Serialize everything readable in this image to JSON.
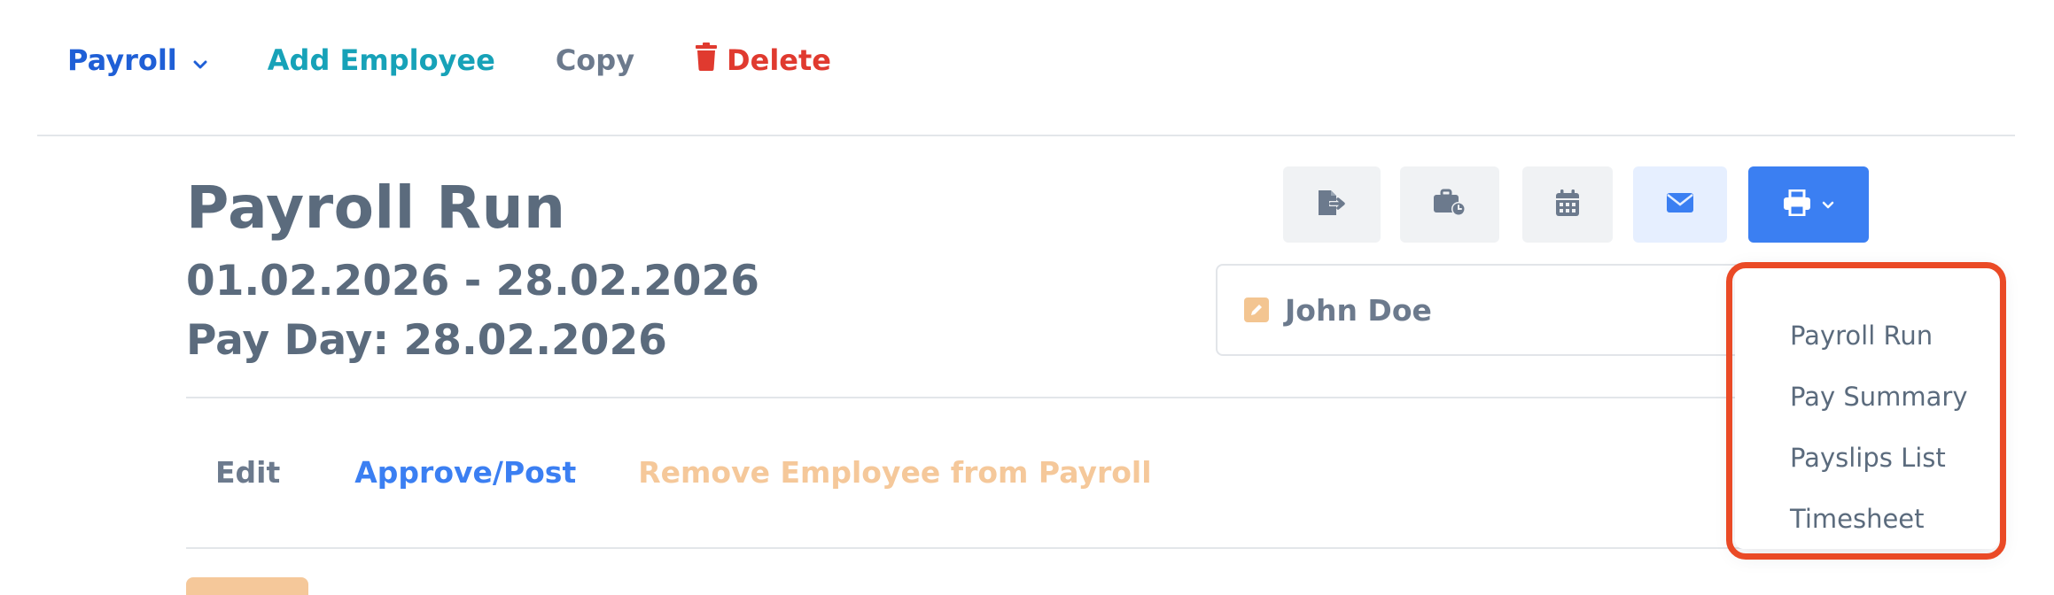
{
  "toolbar": {
    "payroll_label": "Payroll",
    "add_employee_label": "Add Employee",
    "copy_label": "Copy",
    "delete_label": "Delete"
  },
  "header": {
    "title": "Payroll Run",
    "date_range": "01.02.2026 - 28.02.2026",
    "pay_day": "Pay Day: 28.02.2026"
  },
  "actions": {
    "icons": [
      "file-export-icon",
      "briefcase-clock-icon",
      "calendar-icon",
      "envelope-icon",
      "printer-icon"
    ]
  },
  "employee_selector": {
    "selected": "John Doe"
  },
  "tabs": [
    {
      "label": "Edit"
    },
    {
      "label": "Approve/Post"
    },
    {
      "label": "Remove Employee from Payroll"
    }
  ],
  "print_menu": {
    "items": [
      {
        "label": "Payroll Run"
      },
      {
        "label": "Pay Summary"
      },
      {
        "label": "Payslips List"
      },
      {
        "label": "Timesheet"
      }
    ]
  },
  "colors": {
    "primary": "#3b7ff2",
    "teal": "#17a2b8",
    "danger": "#e03a2f",
    "warning_light": "#f5c89a",
    "text": "#5b6b7d",
    "highlight": "#ea4a26"
  }
}
